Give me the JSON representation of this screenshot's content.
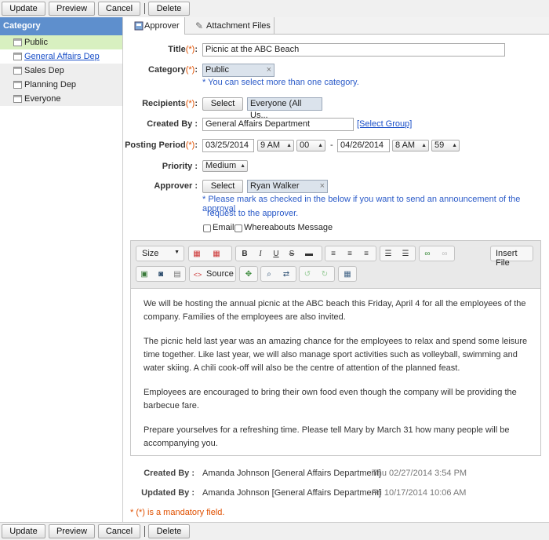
{
  "actions": {
    "update": "Update",
    "preview": "Preview",
    "cancel": "Cancel",
    "delete": "Delete"
  },
  "sidebar": {
    "title": "Category",
    "items": [
      {
        "label": "Public"
      },
      {
        "label": "General Affairs Dep"
      },
      {
        "label": "Sales Dep"
      },
      {
        "label": "Planning Dep"
      },
      {
        "label": "Everyone"
      }
    ]
  },
  "tabs": {
    "approver": "Approver",
    "attachments": "Attachment Files"
  },
  "form": {
    "mandatory_mark": "(*)",
    "title_label": "Title",
    "title_value": "Picnic at the ABC Beach",
    "category_label": "Category",
    "category_value": "Public",
    "category_note": "* You can select more than one category.",
    "recipients_label": "Recipients",
    "recipients_select": "Select",
    "recipients_value": "Everyone (All Us...",
    "created_by_label": "Created By",
    "created_by_value": "General Affairs Department",
    "select_group": "[Select Group]",
    "posting_label": "Posting Period",
    "start_date": "03/25/2014",
    "start_hour": "9 AM",
    "start_min": "00",
    "range_sep": "-",
    "end_date": "04/26/2014",
    "end_hour": "8 AM",
    "end_min": "59",
    "priority_label": "Priority",
    "priority_value": "Medium",
    "approver_label": "Approver",
    "approver_select": "Select",
    "approver_value": "Ryan Walker",
    "approver_note_1": "* Please mark as checked in the below if you want to send an announcement of the approval",
    "approver_note_2": "request to the approver.",
    "email_label": "Email",
    "whereabouts_label": "Whereabouts Message"
  },
  "editor": {
    "size_label": "Size",
    "source_label": "Source",
    "insert_file_label": "Insert File",
    "paragraphs": [
      "We will be hosting the annual picnic at the ABC beach this Friday, April 4 for all the employees of the company. Families of the employees are also invited.",
      "The picnic held last year was an amazing chance for the employees to relax and spend some leisure time together. Like last year, we will also manage sport activities such as volleyball, swimming and water skiing. A chili cook-off will also be the centre of attention of the planned feast.",
      "Employees are encouraged to bring their own food even though the company will be providing the barbecue fare.",
      "Prepare yourselves for a refreshing time. Please tell Mary by March 31 how many people will be accompanying you."
    ]
  },
  "meta": {
    "created_label": "Created By :",
    "created_value": "Amanda Johnson [General Affairs Department]",
    "created_date": "Thu 02/27/2014 3:54 PM",
    "updated_label": "Updated By :",
    "updated_value": "Amanda Johnson [General Affairs Department]",
    "updated_date": "Fri 10/17/2014 10:06 AM",
    "mandatory_note": "* (*) is a mandatory field."
  }
}
